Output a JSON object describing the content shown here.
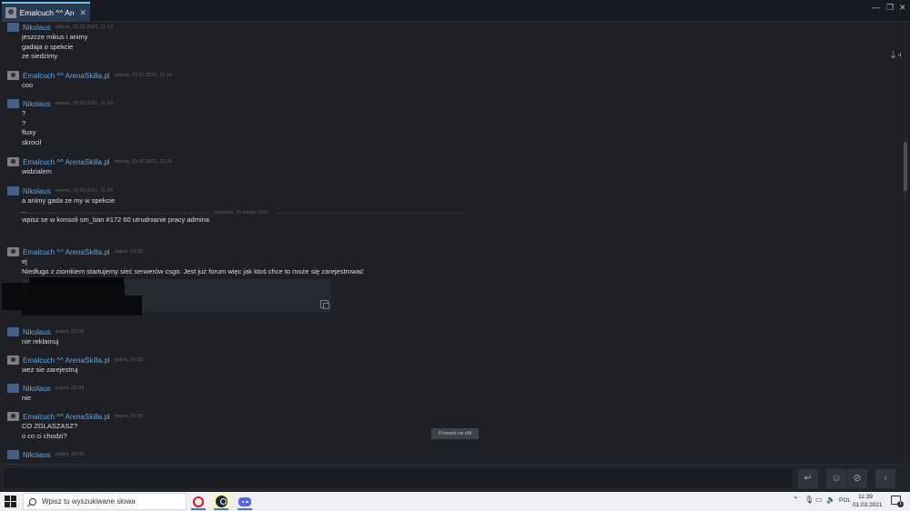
{
  "tab": {
    "title": "Emalcuch ^^ ArenaSkilla.pl",
    "close": "✕"
  },
  "window_controls": {
    "minimize": "—",
    "restore": "❐",
    "close": "✕"
  },
  "messages": [
    {
      "author": "Nikolaus",
      "time": "wtorek, 23.02.2021, 11:14",
      "lines": [
        "jeszcze mikus i animy",
        "gadaja o spekcie",
        "ze siedzimy"
      ]
    },
    {
      "author": "Emalcuch ^^ ArenaSkilla.pl",
      "time": "wtorek, 23.02.2021, 11:14",
      "lines": [
        "coo"
      ]
    },
    {
      "author": "Nikolaus",
      "time": "wtorek, 23.02.2021, 11:14",
      "lines": [
        "?",
        "?",
        "fluxy",
        "skrocil"
      ]
    },
    {
      "author": "Emalcuch ^^ ArenaSkilla.pl",
      "time": "wtorek, 23.02.2021, 11:15",
      "lines": [
        "widzialem"
      ]
    },
    {
      "author": "Nikolaus",
      "time": "wtorek, 23.02.2021, 11:15",
      "lines": [
        "a animy gada ze my w spekcie",
        "..",
        "wpisz se w konsoli sm_ban #172 60 utrudnianie pracy admina"
      ]
    },
    {
      "author": "Emalcuch ^^ ArenaSkilla.pl",
      "time": "piątek, 09:33",
      "lines": [
        "ej",
        "Niedługo z ziomkiem startujemy sieć serwerów csgo. Jest już forum więc jak ktoś chce to może się zarejestrować"
      ]
    },
    {
      "author": "Nikolaus",
      "time": "piątek, 09:33",
      "lines": [
        "nie reklamuj"
      ]
    },
    {
      "author": "Emalcuch ^^ ArenaSkilla.pl",
      "time": "piątek, 09:33",
      "lines": [
        "wez sie zarejestruj"
      ]
    },
    {
      "author": "Nikolaus",
      "time": "piątek, 09:33",
      "lines": [
        "nie"
      ]
    },
    {
      "author": "Emalcuch ^^ ArenaSkilla.pl",
      "time": "piątek, 09:38",
      "lines": [
        "CO ZGLASZASZ?",
        "o co ci chodzi?"
      ]
    },
    {
      "author": "Nikolaus",
      "time": "piątek, 09:38",
      "lines": []
    }
  ],
  "day_divider": "czwartek, 25 lutego 2021",
  "jump_button": "Przewiń na dół",
  "taskbar": {
    "search_placeholder": "Wpisz tu wyszukiwane słowa",
    "language": "POL",
    "time": "11:39",
    "date": "01.03.2021",
    "notification_count": "1"
  },
  "colors": {
    "accent": "#67c1f5",
    "name_blue": "#62a7e3",
    "name_green": "#8bc53f",
    "background": "#1e2025"
  }
}
